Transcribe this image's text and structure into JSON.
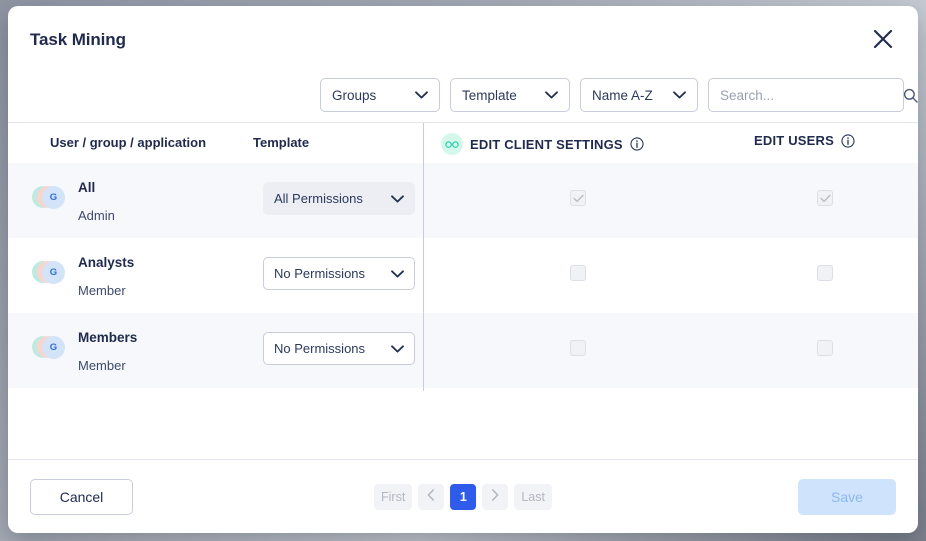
{
  "dialog": {
    "title": "Task Mining",
    "close_icon": "close-icon"
  },
  "filters": {
    "groups": {
      "label": "Groups",
      "icon": "chevron-down-icon"
    },
    "template": {
      "label": "Template",
      "icon": "chevron-down-icon"
    },
    "sort": {
      "label": "Name A-Z",
      "icon": "chevron-down-icon"
    },
    "search": {
      "value": "",
      "placeholder": "Search...",
      "icon": "search-icon"
    }
  },
  "table": {
    "columns": {
      "user_group_application": "User / group / application",
      "template": "Template"
    },
    "permission_columns": [
      {
        "label": "EDIT CLIENT SETTINGS",
        "badge_icon": "glasses-icon",
        "info_icon": "info-icon",
        "has_badge": true
      },
      {
        "label": "EDIT USERS",
        "info_icon": "info-icon",
        "has_badge": false
      }
    ],
    "rows": [
      {
        "avatar_initial": "G",
        "name": "All",
        "role": "Admin",
        "template": "All Permissions",
        "template_style": "filled",
        "chevron_icon": "chevron-down-icon",
        "permissions": [
          {
            "checked": true,
            "disabled": true
          },
          {
            "checked": true,
            "disabled": true
          }
        ],
        "shaded": true
      },
      {
        "avatar_initial": "G",
        "name": "Analysts",
        "role": "Member",
        "template": "No Permissions",
        "template_style": "outline",
        "chevron_icon": "chevron-down-icon",
        "permissions": [
          {
            "checked": false,
            "disabled": true
          },
          {
            "checked": false,
            "disabled": true
          }
        ],
        "shaded": false
      },
      {
        "avatar_initial": "G",
        "name": "Members",
        "role": "Member",
        "template": "No Permissions",
        "template_style": "outline",
        "chevron_icon": "chevron-down-icon",
        "permissions": [
          {
            "checked": false,
            "disabled": true
          },
          {
            "checked": false,
            "disabled": true
          }
        ],
        "shaded": true
      }
    ]
  },
  "pagination": {
    "first": "First",
    "prev_icon": "chevron-left-icon",
    "pages": [
      "1"
    ],
    "current_page": "1",
    "next_icon": "chevron-right-icon",
    "last": "Last"
  },
  "footer": {
    "cancel": "Cancel",
    "save": "Save",
    "save_disabled": true
  },
  "colors": {
    "accent": "#2f5bea",
    "title_text": "#1f2a4d",
    "border": "#c9ccdb",
    "row_shade": "#f7f8fb",
    "badge_mint": "#d6f7ec",
    "badge_glasses": "#2fd0ac",
    "save_disabled_bg": "#cfe3fd"
  }
}
